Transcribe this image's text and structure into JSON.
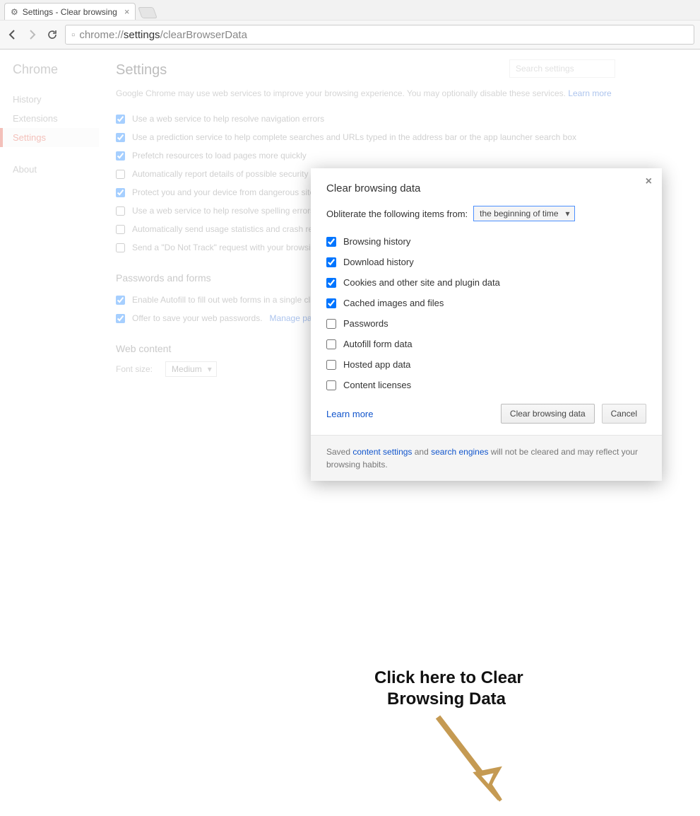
{
  "tab": {
    "title": "Settings - Clear browsing"
  },
  "url": {
    "protocol": "chrome://",
    "bold": "settings",
    "rest": "/clearBrowserData"
  },
  "sidebar": {
    "brand": "Chrome",
    "items": [
      "History",
      "Extensions",
      "Settings",
      "About"
    ],
    "active_index": 2
  },
  "settings": {
    "title": "Settings",
    "search_placeholder": "Search settings",
    "intro_a": "Google Chrome may use web services to improve your browsing experience. You may optionally disable these services. ",
    "learn_more": "Learn more",
    "checks": [
      {
        "checked": true,
        "label": "Use a web service to help resolve navigation errors"
      },
      {
        "checked": true,
        "label": "Use a prediction service to help complete searches and URLs typed in the address bar or the app launcher search box"
      },
      {
        "checked": true,
        "label": "Prefetch resources to load pages more quickly"
      },
      {
        "checked": false,
        "label": "Automatically report details of possible security incidents to Google"
      },
      {
        "checked": true,
        "label": "Protect you and your device from dangerous sites"
      },
      {
        "checked": false,
        "label": "Use a web service to help resolve spelling errors"
      },
      {
        "checked": false,
        "label": "Automatically send usage statistics and crash reports to Google"
      },
      {
        "checked": false,
        "label": "Send a \"Do Not Track\" request with your browsing traffic"
      }
    ],
    "pw_heading": "Passwords and forms",
    "pw_checks": [
      {
        "checked": true,
        "label": "Enable Autofill to fill out web forms in a single click."
      },
      {
        "checked": true,
        "label": "Offer to save your web passwords. ",
        "link": "Manage passwords"
      }
    ],
    "web_heading": "Web content",
    "font_label": "Font size:",
    "font_value": "Medium"
  },
  "dialog": {
    "title": "Clear browsing data",
    "obliterate_label": "Obliterate the following items from:",
    "time_value": "the beginning of time",
    "items": [
      {
        "checked": true,
        "label": "Browsing history"
      },
      {
        "checked": true,
        "label": "Download history"
      },
      {
        "checked": true,
        "label": "Cookies and other site and plugin data"
      },
      {
        "checked": true,
        "label": "Cached images and files"
      },
      {
        "checked": false,
        "label": "Passwords"
      },
      {
        "checked": false,
        "label": "Autofill form data"
      },
      {
        "checked": false,
        "label": "Hosted app data"
      },
      {
        "checked": false,
        "label": "Content licenses"
      }
    ],
    "learn_more": "Learn more",
    "primary_btn": "Clear browsing data",
    "cancel_btn": "Cancel",
    "footer_a": "Saved ",
    "footer_link1": "content settings",
    "footer_mid": " and ",
    "footer_link2": "search engines",
    "footer_b": " will not be cleared and may reflect your browsing habits."
  },
  "annotation": {
    "line1": "Click here to Clear",
    "line2": "Browsing Data"
  }
}
